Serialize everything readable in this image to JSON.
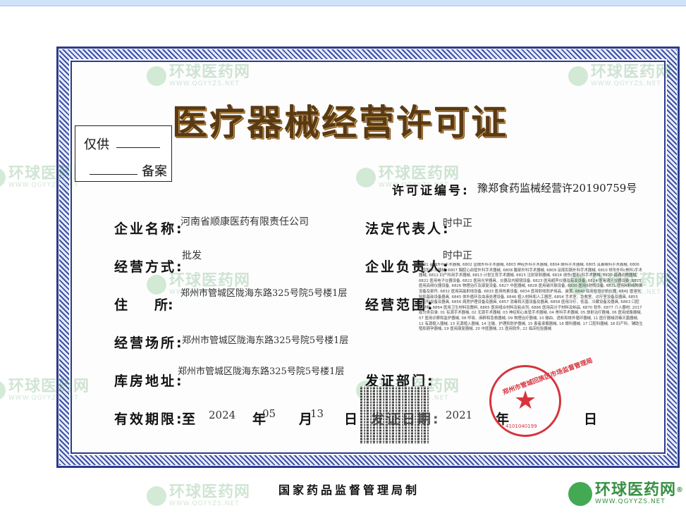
{
  "title": "医疗器械经营许可证",
  "record_box": {
    "line1": "仅供",
    "line2": "备案"
  },
  "license_no": {
    "label": "许可证编号:",
    "value": "豫郑食药监械经营许20190759号"
  },
  "company_name": {
    "label": "企业名称:",
    "value": "河南省顺康医药有限责任公司"
  },
  "legal_rep": {
    "label": "法定代表人:",
    "value": "时中正"
  },
  "business_mode": {
    "label": "经营方式:",
    "value": "批发"
  },
  "company_head": {
    "label": "企业负责人:",
    "value": "时中正"
  },
  "residence": {
    "label": "住　　所:",
    "value": "郑州市管城区陇海东路325号院5号楼1层"
  },
  "business_scope": {
    "label": "经营范围:",
    "value": "6801 基础外科手术器械, 6802 显微外科手术器械, 6803 神经外科手术器械, 6804 眼科手术器械, 6805 耳鼻喉科手术器械, 6806 口腔科手术器械, 6807 胸腔心血管外科手术器械, 6808 腹部外科手术器械, 6809 泌尿肛肠外科手术器械, 6810 矫形外科(骨科)手术器械, 6812 妇产科用手术器械, 6813 计划生育手术器械, 6815 注射穿刺器械, 6816 烧伤(整形)科手术器械, 6820 普通诊察器械, 6821 医用电子仪器设备, 6822 医用光学器具、仪器及内窥镜设备, 6823 医用超声仪器及有关设备, 6824 医用激光仪器设备, 6825 医用高频仪器设备, 6826 物理治疗及康复设备, 6827 中医器械, 6828 医用磁共振设备, 6830 医用X射线设备, 6831 医用X射线附属设备及部件, 6832 医用高能射线设备, 6833 医用核素设备, 6834 医用射线防护用品、装置, 6840 临床检验分析仪器, 6841 医用化验和基础设备器具, 6845 体外循环及血液处理设备, 6846 植入材料和人工器官, 6854 手术室、急救室、诊疗室设备及器具, 6855 口腔科设备及器具, 6856 病房护理设备及器具, 6857 消毒和灭菌设备及器具, 6858 医用冷疗、低温、冷藏设备及器具, 6863 口腔科材料, 6864 医用卫生材料及敷料, 6865 医用缝合材料及粘合剂, 6866 医用高分子材料及制品, 6870 软件, 6877 介入器材; 2017版分类目录: 01 有源手术器械, 02 无源手术器械, 03 神经和心血管手术器械, 04 骨科手术器械, 05 放射治疗器械, 06 医用成像器械, 07 医用诊察和监护器械, 08 呼吸、麻醉和急救器械, 09 物理治疗器械, 10 输血、透析和体外循环器械, 11 医疗器械消毒灭菌器械, 12 有源植入器械, 13 无源植入器械, 14 注输、护理和防护器械, 15 患者承载器械, 16 眼科器械, 17 口腔科器械, 18 妇产科、辅助生殖和避孕器械, 19 医用康复器械, 20 中医器械, 21 医用软件, 22 临床检验器械"
  },
  "business_place": {
    "label": "经营场所:",
    "value": "郑州市管城区陇海东路325号院5号楼1层"
  },
  "warehouse": {
    "label": "库房地址:",
    "value": "郑州市管城区陇海东路325号院5号楼1层"
  },
  "issuer": {
    "label": "发证部门:"
  },
  "validity": {
    "label": "有效期限:",
    "to": "至",
    "year": "2024",
    "year_char": "年",
    "month": "05",
    "month_char": "月",
    "day": "13",
    "day_char": "日"
  },
  "issue_date": {
    "label": "发证日期:",
    "year": "2021",
    "year_char": "年",
    "day_char": "日"
  },
  "seal": {
    "text": "郑州市管城回族区市场监督管理局",
    "number": "4101040199"
  },
  "footer": "国家药品监督管理局制",
  "watermark": {
    "name": "环球医药网",
    "url": "WWW.QGYYZS.NET",
    "mark": "®"
  },
  "colors": {
    "border": "#2b3b8c",
    "title": "#5a3a14",
    "seal": "#d8333d",
    "watermark": "#2e8b3a"
  }
}
